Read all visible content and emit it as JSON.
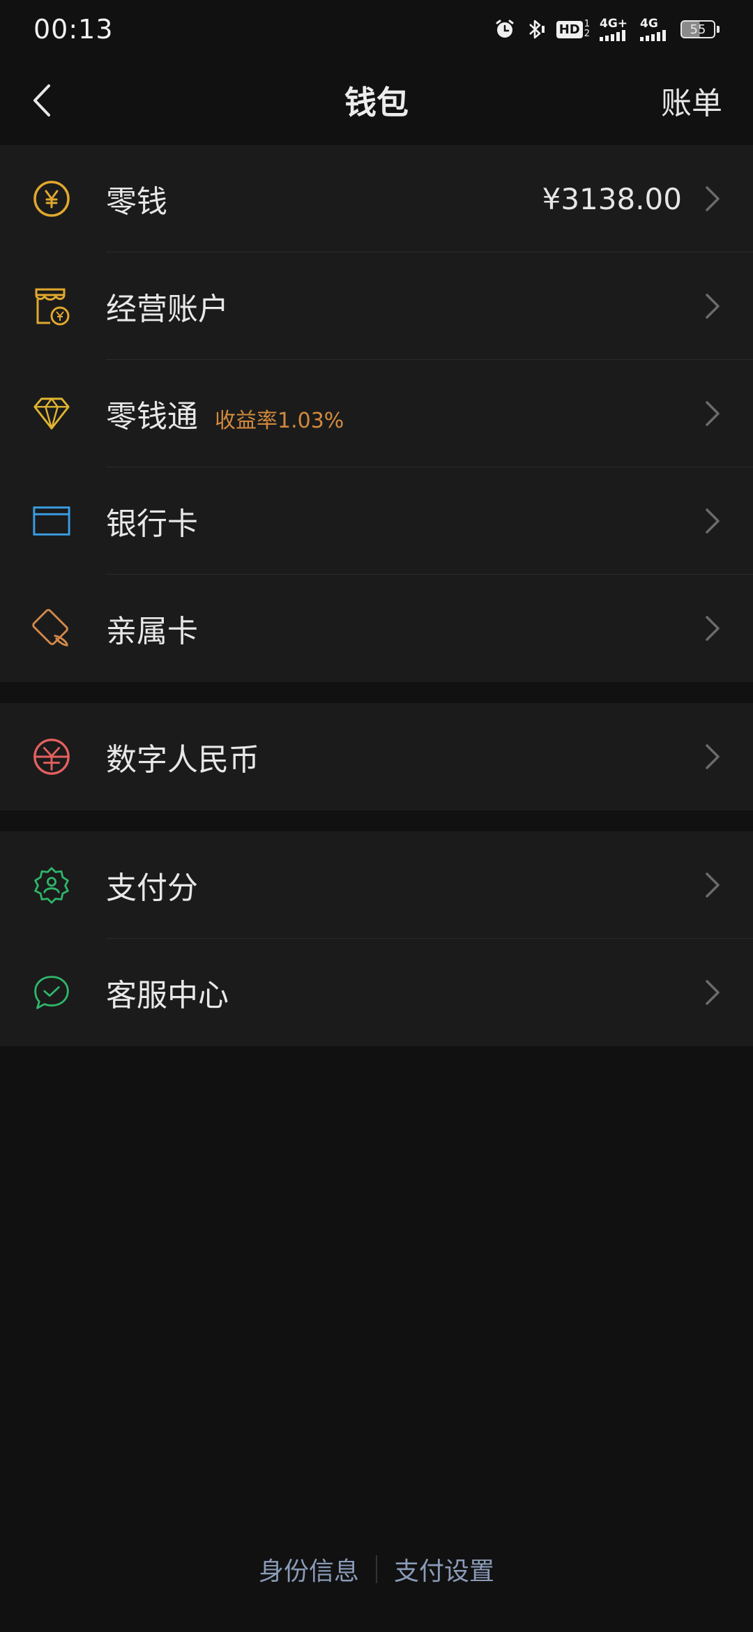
{
  "status_bar": {
    "time": "00:13",
    "hd_label": "HD",
    "net1": "4G+",
    "net2": "4G",
    "battery": "55",
    "icons": [
      "alarm-icon",
      "bluetooth-icon",
      "hd-icon",
      "signal-4g-plus-icon",
      "signal-4g-icon",
      "battery-icon"
    ]
  },
  "nav": {
    "title": "钱包",
    "action": "账单",
    "back_icon": "chevron-left-icon"
  },
  "groups": [
    {
      "rows": [
        {
          "name": "wallet-row-change",
          "icon": "yuan-coin-icon",
          "label": "零钱",
          "value": "¥3138.00",
          "color": "#e0a82e"
        },
        {
          "name": "wallet-row-business-account",
          "icon": "shop-icon",
          "label": "经营账户",
          "color": "#e0a82e"
        },
        {
          "name": "wallet-row-lingqiantong",
          "icon": "diamond-icon",
          "label": "零钱通",
          "tag": "收益率1.03%",
          "color": "#e0b530"
        },
        {
          "name": "wallet-row-bank-card",
          "icon": "card-icon",
          "label": "银行卡",
          "color": "#3a9ee6"
        },
        {
          "name": "wallet-row-family-card",
          "icon": "family-card-icon",
          "label": "亲属卡",
          "color": "#d3894a"
        }
      ]
    },
    {
      "rows": [
        {
          "name": "wallet-row-digital-rmb",
          "icon": "digital-rmb-icon",
          "label": "数字人民币",
          "color": "#e4605e"
        }
      ]
    },
    {
      "rows": [
        {
          "name": "wallet-row-pay-score",
          "icon": "badge-person-icon",
          "label": "支付分",
          "color": "#2fb66a"
        },
        {
          "name": "wallet-row-customer-service",
          "icon": "chat-check-icon",
          "label": "客服中心",
          "color": "#2fb66a"
        }
      ]
    }
  ],
  "footer": {
    "identity": "身份信息",
    "pay_settings": "支付设置"
  }
}
